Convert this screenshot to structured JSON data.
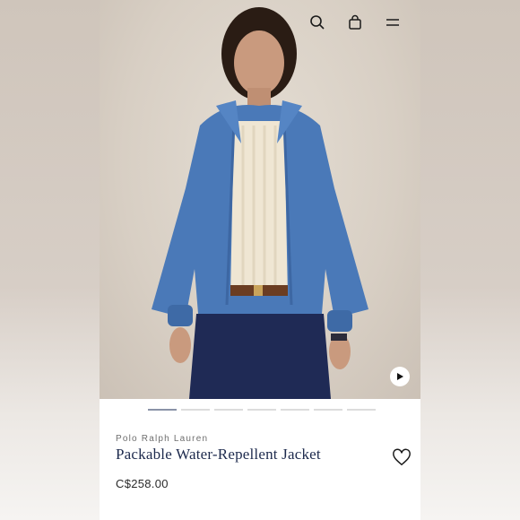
{
  "header": {
    "icons": [
      "search-icon",
      "bag-icon",
      "menu-icon"
    ]
  },
  "product": {
    "brand": "Polo Ralph Lauren",
    "name": "Packable Water-Repellent Jacket",
    "price": "C$258.00"
  },
  "gallery": {
    "image_count": 7,
    "active_index": 0,
    "play_icon": "play-icon"
  },
  "colors": {
    "title": "#1d2a4d",
    "jacket": "#4a79b8",
    "trousers": "#1f2a55",
    "active_dot": "#8a93a8"
  }
}
